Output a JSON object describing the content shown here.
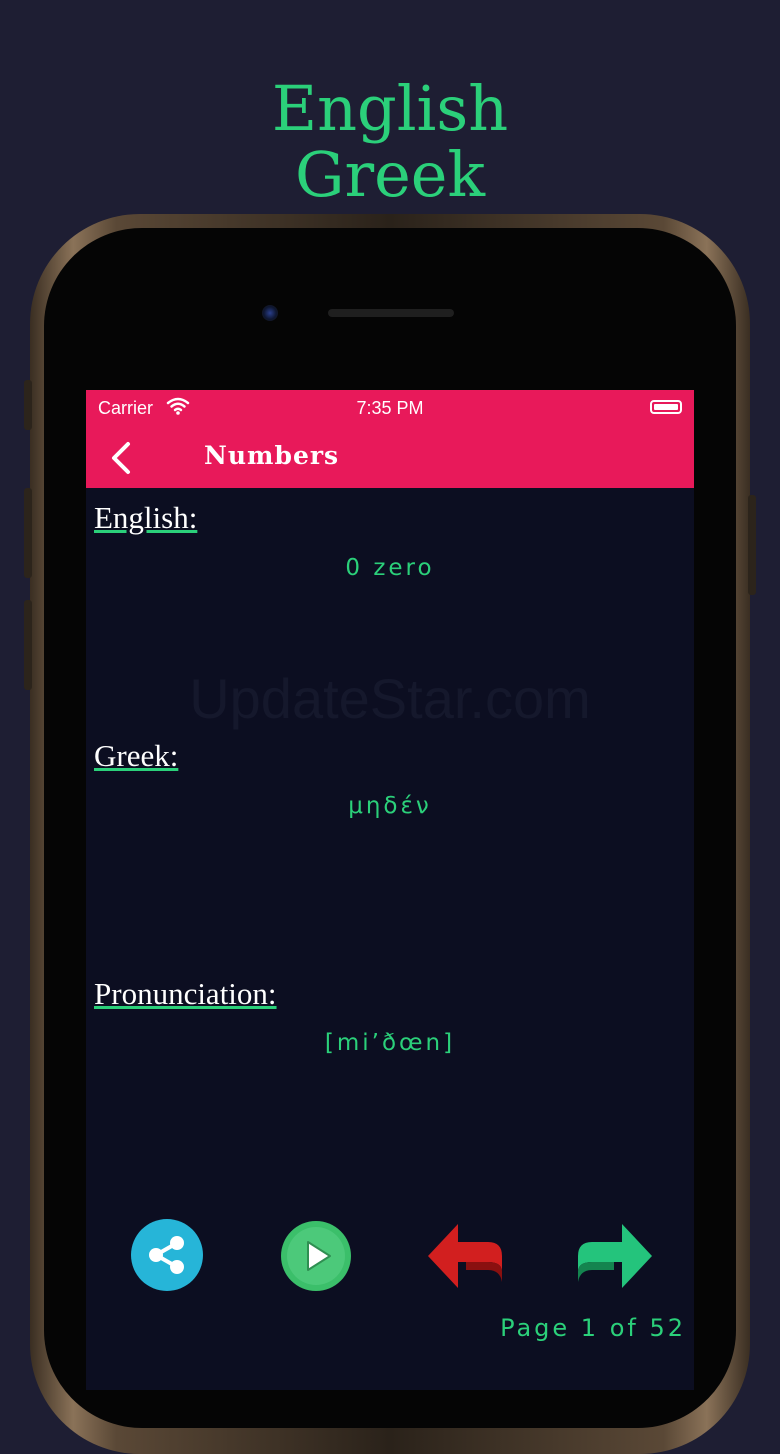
{
  "promo": {
    "line1": "English",
    "line2": "Greek"
  },
  "statusbar": {
    "carrier": "Carrier",
    "time": "7:35 PM"
  },
  "navbar": {
    "title": "Numbers"
  },
  "sections": {
    "english": {
      "label": "English:",
      "value": "0 zero"
    },
    "greek": {
      "label": "Greek:",
      "value": "μηδέν"
    },
    "pronunciation": {
      "label": "Pronunciation:",
      "value": "[mi’ðœn]"
    }
  },
  "watermark": "UpdateStar.com",
  "controls": {
    "share_color": "#26b5d8",
    "play_color": "#3bbf6a",
    "prev_color": "#d21f1f",
    "next_color": "#24c47c"
  },
  "page_indicator": "Page 1 of 52",
  "colors": {
    "background": "#1e1e33",
    "accent_green": "#2bd07a",
    "bar_pink": "#e8195a",
    "screen_bg": "#0c0e21"
  }
}
